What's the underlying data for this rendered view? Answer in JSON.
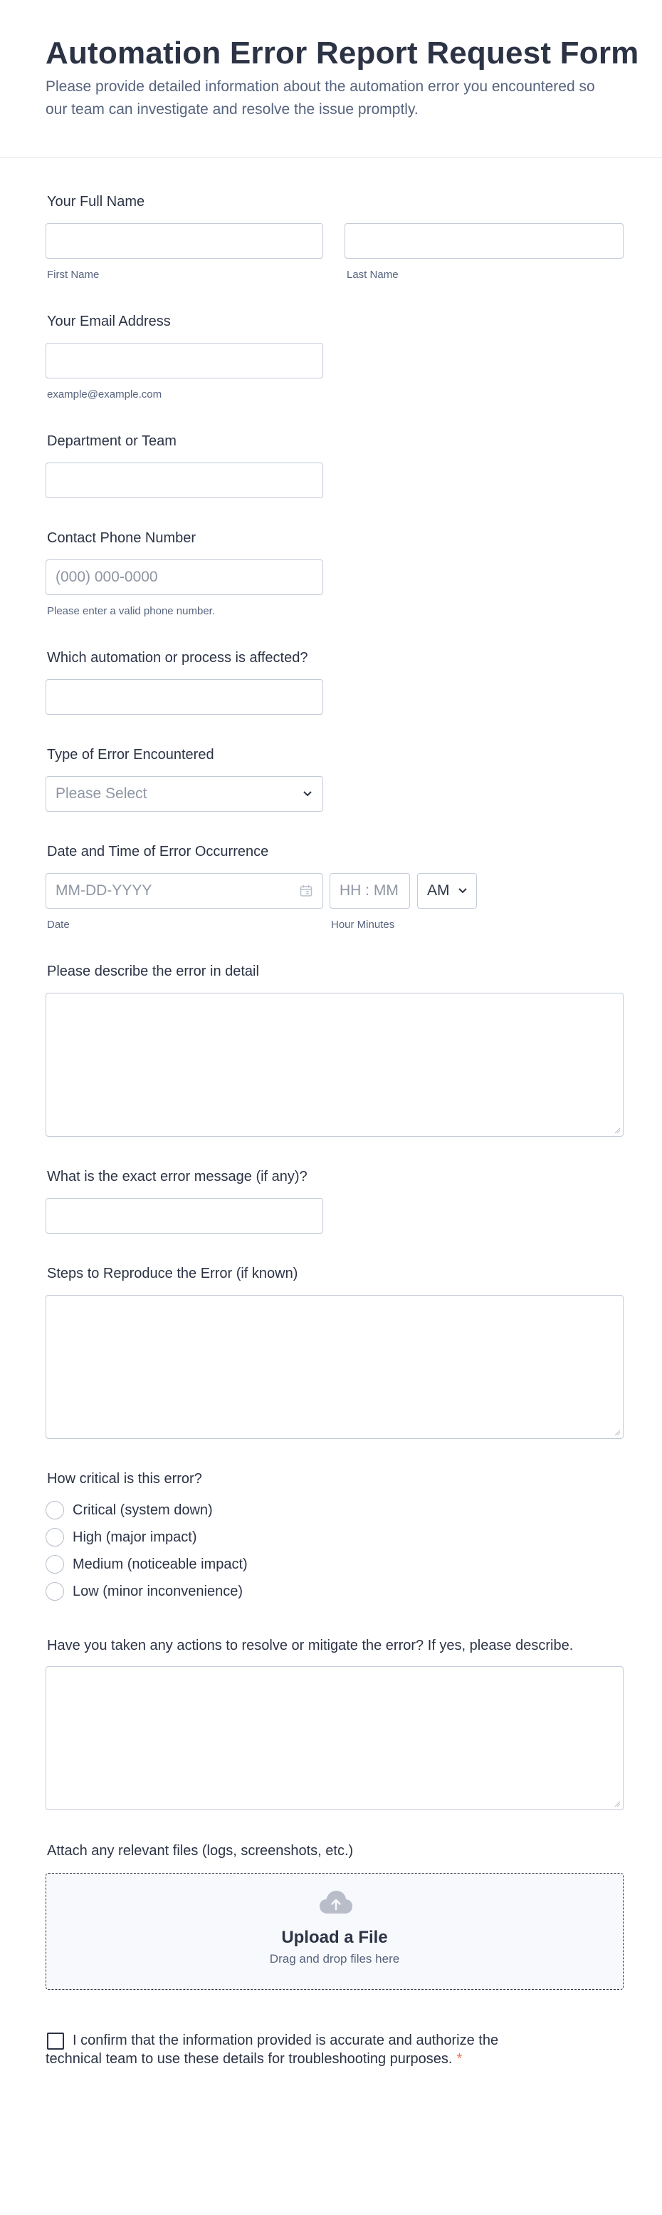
{
  "header": {
    "title": "Automation Error Report Request Form",
    "subtitle": "Please provide detailed information about the automation error you encountered so our team can investigate and resolve the issue promptly."
  },
  "fields": {
    "full_name": {
      "label": "Your Full Name",
      "first_sublabel": "First Name",
      "last_sublabel": "Last Name"
    },
    "email": {
      "label": "Your Email Address",
      "sublabel": "example@example.com"
    },
    "department": {
      "label": "Department or Team"
    },
    "phone": {
      "label": "Contact Phone Number",
      "placeholder": "(000) 000-0000",
      "sublabel": "Please enter a valid phone number."
    },
    "automation": {
      "label": "Which automation or process is affected?"
    },
    "error_type": {
      "label": "Type of Error Encountered",
      "selected": "Please Select"
    },
    "datetime": {
      "label": "Date and Time of Error Occurrence",
      "date_placeholder": "MM-DD-YYYY",
      "time_placeholder": "HH : MM",
      "ampm": "AM",
      "date_sublabel": "Date",
      "time_sublabel": "Hour Minutes"
    },
    "description": {
      "label": "Please describe the error in detail"
    },
    "error_message": {
      "label": "What is the exact error message (if any)?"
    },
    "steps": {
      "label": "Steps to Reproduce the Error (if known)"
    },
    "criticality": {
      "label": "How critical is this error?",
      "options": [
        "Critical (system down)",
        "High (major impact)",
        "Medium (noticeable impact)",
        "Low (minor inconvenience)"
      ]
    },
    "actions": {
      "label": "Have you taken any actions to resolve or mitigate the error? If yes, please describe."
    },
    "attachments": {
      "label": "Attach any relevant files (logs, screenshots, etc.)",
      "upload_title": "Upload a File",
      "upload_hint": "Drag and drop files here"
    },
    "confirm": {
      "text": "I confirm that the information provided is accurate and authorize the technical team to use these details for troubleshooting purposes.",
      "required_mark": "*"
    }
  },
  "icons": {
    "calendar": "calendar-icon",
    "chevron": "chevron-down-icon",
    "upload": "cloud-upload-icon"
  },
  "colors": {
    "text": "#2c3345",
    "muted": "#57647e",
    "border": "#c3cad8",
    "required": "#f2744e",
    "upload_bg": "#f8f9fc"
  }
}
